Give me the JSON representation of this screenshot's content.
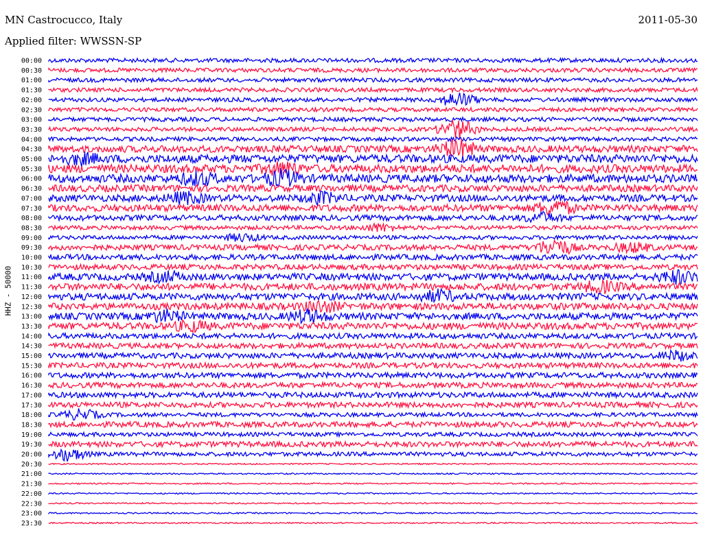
{
  "header": {
    "station": "MN Castrocucco, Italy",
    "date": "2011-05-30",
    "filter": "Applied filter: WWSSN-SP"
  },
  "colors": {
    "line_a": "#0000ee",
    "line_b": "#ff1040"
  },
  "chart_data": {
    "type": "line",
    "title": "MN Castrocucco, Italy",
    "subtitle": "Applied filter: WWSSN-SP",
    "ylabel": "HHZ - 50000",
    "rows": [
      "00:00",
      "00:30",
      "01:00",
      "01:30",
      "02:00",
      "02:30",
      "03:00",
      "03:30",
      "04:00",
      "04:30",
      "05:00",
      "05:30",
      "06:00",
      "06:30",
      "07:00",
      "07:30",
      "08:00",
      "08:30",
      "09:00",
      "09:30",
      "10:00",
      "10:30",
      "11:00",
      "11:30",
      "12:00",
      "12:30",
      "13:00",
      "13:30",
      "14:00",
      "14:30",
      "15:00",
      "15:30",
      "16:00",
      "16:30",
      "17:00",
      "17:30",
      "18:00",
      "18:30",
      "19:00",
      "19:30",
      "20:00",
      "20:30",
      "21:00",
      "21:30",
      "22:00",
      "22:30",
      "23:00",
      "23:30"
    ],
    "row_noise_level": [
      3,
      3,
      3,
      3,
      3,
      3,
      3,
      3,
      3,
      5,
      6,
      6,
      6,
      5,
      5,
      5,
      4,
      3,
      3,
      4,
      4,
      4,
      5,
      5,
      5,
      5,
      5,
      5,
      4,
      4,
      4,
      4,
      4,
      4,
      4,
      4,
      3,
      4,
      3,
      4,
      3,
      1,
      1,
      1,
      1,
      1,
      1,
      1
    ],
    "events": [
      {
        "row": "02:00",
        "pos": 0.63,
        "amp": 10
      },
      {
        "row": "03:30",
        "pos": 0.63,
        "amp": 14
      },
      {
        "row": "04:30",
        "pos": 0.63,
        "amp": 12
      },
      {
        "row": "05:00",
        "pos": 0.05,
        "amp": 6
      },
      {
        "row": "05:30",
        "pos": 0.36,
        "amp": 8
      },
      {
        "row": "06:00",
        "pos": 0.23,
        "amp": 8
      },
      {
        "row": "06:00",
        "pos": 0.36,
        "amp": 10
      },
      {
        "row": "07:00",
        "pos": 0.21,
        "amp": 7
      },
      {
        "row": "07:00",
        "pos": 0.42,
        "amp": 7
      },
      {
        "row": "07:30",
        "pos": 0.78,
        "amp": 10
      },
      {
        "row": "08:00",
        "pos": 0.76,
        "amp": 6
      },
      {
        "row": "08:30",
        "pos": 0.51,
        "amp": 5
      },
      {
        "row": "09:00",
        "pos": 0.3,
        "amp": 5
      },
      {
        "row": "09:30",
        "pos": 0.78,
        "amp": 12
      },
      {
        "row": "09:30",
        "pos": 0.9,
        "amp": 6
      },
      {
        "row": "11:00",
        "pos": 0.18,
        "amp": 6
      },
      {
        "row": "11:00",
        "pos": 0.97,
        "amp": 8
      },
      {
        "row": "11:30",
        "pos": 0.85,
        "amp": 7
      },
      {
        "row": "12:00",
        "pos": 0.6,
        "amp": 7
      },
      {
        "row": "12:30",
        "pos": 0.42,
        "amp": 7
      },
      {
        "row": "13:00",
        "pos": 0.18,
        "amp": 7
      },
      {
        "row": "13:00",
        "pos": 0.4,
        "amp": 8
      },
      {
        "row": "13:30",
        "pos": 0.22,
        "amp": 6
      },
      {
        "row": "15:00",
        "pos": 0.97,
        "amp": 6
      },
      {
        "row": "18:00",
        "pos": 0.05,
        "amp": 7
      },
      {
        "row": "20:00",
        "pos": 0.03,
        "amp": 9
      }
    ]
  }
}
